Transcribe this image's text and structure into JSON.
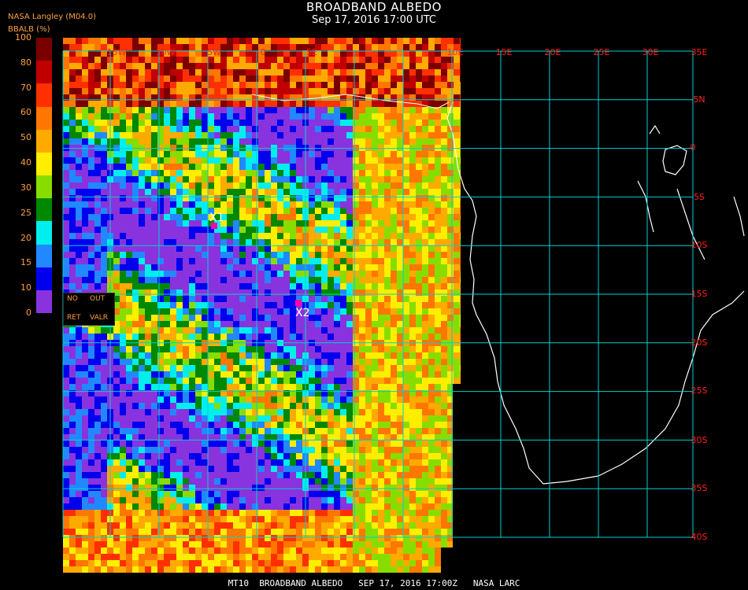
{
  "header": {
    "title": "BROADBAND ALBEDO",
    "datetime": "Sep 17, 2016 17:00 UTC",
    "credit": "NASA Langley (M04.0)",
    "unit_label": "BBALB (%)"
  },
  "colorbar": {
    "ticks": [
      "100",
      "80",
      "70",
      "60",
      "50",
      "40",
      "30",
      "25",
      "20",
      "15",
      "10",
      "0"
    ],
    "colors": [
      "#7a0000",
      "#c00000",
      "#ff3000",
      "#ff7700",
      "#ffaa00",
      "#ffee00",
      "#88dd00",
      "#008800",
      "#00eeee",
      "#2288ff",
      "#0000ee",
      "#8833dd"
    ]
  },
  "legend": {
    "no": "NO",
    "out": "OUT",
    "ret": "RET",
    "valr": "VALR"
  },
  "grid": {
    "lon_labels": [
      "15W",
      "10W",
      "5W",
      "0",
      "5E",
      "10E",
      "15E",
      "20E",
      "25E",
      "30E",
      "35E"
    ],
    "lat_labels": [
      "5N",
      "0",
      "5S",
      "10S",
      "15S",
      "20S",
      "25S",
      "30S",
      "35S",
      "40S"
    ],
    "line_color": "#00d0d0",
    "label_color": "#ff2020"
  },
  "markers": {
    "x1": "X1",
    "x2": "X2",
    "color": "#ff00aa"
  },
  "footer": {
    "text": "MT10  BROADBAND ALBEDO   SEP 17, 2016 17:00Z   NASA LARC"
  }
}
